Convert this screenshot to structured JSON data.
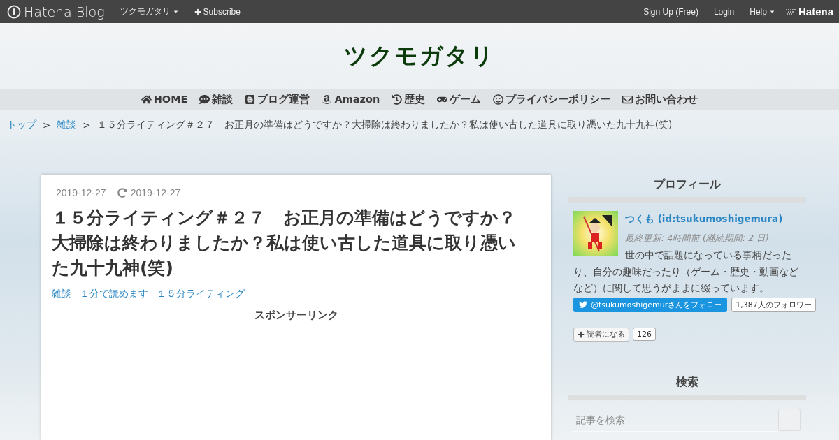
{
  "topbar": {
    "brand": "Hatena Blog",
    "blog_menu": "ツクモガタリ",
    "subscribe": "Subscribe",
    "right_links": [
      "Sign Up (Free)",
      "Login"
    ],
    "help": "Help",
    "hatena": "Hatena"
  },
  "blog_title": "ツクモガタリ",
  "nav": [
    {
      "kind": "home",
      "label": "HOME"
    },
    {
      "kind": "chat",
      "label": "雑談"
    },
    {
      "kind": "blog",
      "label": "ブログ運営"
    },
    {
      "kind": "amazon",
      "label": "Amazon"
    },
    {
      "kind": "history",
      "label": "歴史"
    },
    {
      "kind": "game",
      "label": "ゲーム"
    },
    {
      "kind": "smile",
      "label": "プライバシーポリシー"
    },
    {
      "kind": "mail",
      "label": "お問い合わせ"
    }
  ],
  "breadcrumb": {
    "links": [
      "トップ",
      "雑談"
    ],
    "separator": ">",
    "current": "１５分ライティング＃２７　お正月の準備はどうですか？大掃除は終わりましたか？私は使い古した道具に取り憑いた九十九神(笑)"
  },
  "article": {
    "date": "2019-12-27",
    "updated": "2019-12-27",
    "title": "１５分ライティング＃２７　お正月の準備はどうですか？大掃除は終わりましたか？私は使い古した道具に取り憑いた九十九神(笑)",
    "categories": [
      "雑談",
      "１分で読めます",
      "１５分ライティング"
    ],
    "sponsor": "スポンサーリンク"
  },
  "sidebar": {
    "profile": {
      "heading": "プロフィール",
      "name": "つくも (id:tsukumoshigemura)",
      "last_update": "最終更新: 4時間前 (継続期間: 2 日)",
      "bio": "世の中で話題になっている事柄だったり、自分の趣味だったり（ゲーム・歴史・動画などなど）に関して思うがままに綴っています。",
      "twitter_follow": "@tsukumoshigemurさんをフォロー",
      "twitter_count": "1,387人のフォロワー",
      "reader_button": "読者になる",
      "reader_count": "126"
    },
    "search": {
      "heading": "検索",
      "placeholder": "記事を検索"
    }
  }
}
